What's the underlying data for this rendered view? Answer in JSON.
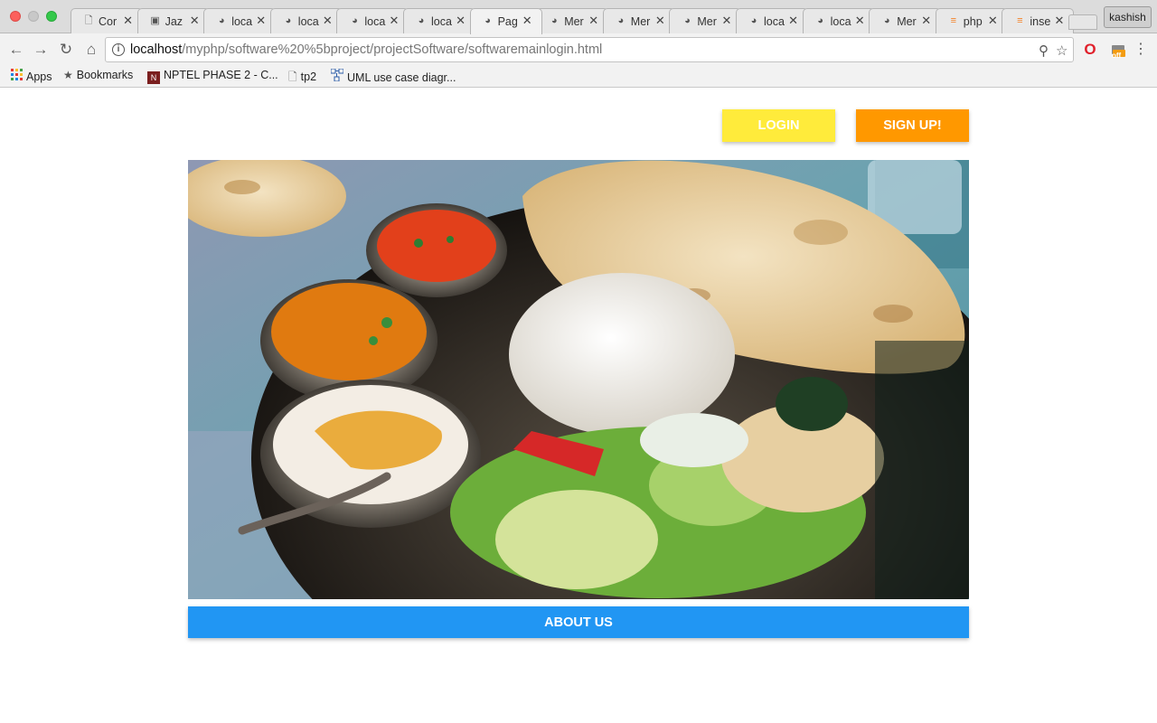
{
  "browser": {
    "tabs": [
      {
        "title": "Cor",
        "icon": "page-icon"
      },
      {
        "title": "Jaz",
        "icon": "chat-icon"
      },
      {
        "title": "loca",
        "icon": "elephant-icon"
      },
      {
        "title": "loca",
        "icon": "elephant-icon"
      },
      {
        "title": "loca",
        "icon": "elephant-icon"
      },
      {
        "title": "loca",
        "icon": "elephant-icon"
      },
      {
        "title": "Pag",
        "icon": "elephant-icon",
        "active": true
      },
      {
        "title": "Mer",
        "icon": "elephant-icon"
      },
      {
        "title": "Mer",
        "icon": "elephant-icon"
      },
      {
        "title": "Mer",
        "icon": "elephant-icon"
      },
      {
        "title": "loca",
        "icon": "elephant-icon"
      },
      {
        "title": "loca",
        "icon": "elephant-icon"
      },
      {
        "title": "Mer",
        "icon": "elephant-icon"
      },
      {
        "title": "php",
        "icon": "stackoverflow-icon"
      },
      {
        "title": "inse",
        "icon": "stackoverflow-icon"
      }
    ],
    "profile_name": "kashish",
    "url_host": "localhost",
    "url_path": "/myphp/software%20%5bproject/projectSoftware/softwaremainlogin.html",
    "bookmarks": [
      {
        "label": "Apps",
        "icon": "apps-grid-icon"
      },
      {
        "label": "Bookmarks",
        "icon": "star-icon"
      },
      {
        "label": "NPTEL PHASE 2 - C...",
        "icon": "nptel-icon"
      },
      {
        "label": "tp2",
        "icon": "page-icon"
      },
      {
        "label": "UML use case diagr...",
        "icon": "diagram-icon"
      }
    ],
    "extension_badge": "off"
  },
  "page": {
    "login_label": "LOGIN",
    "signup_label": "SIGN UP!",
    "about_label": "ABOUT US"
  },
  "colors": {
    "login": "#ffeb3b",
    "signup": "#ff9800",
    "about": "#2196f3"
  }
}
